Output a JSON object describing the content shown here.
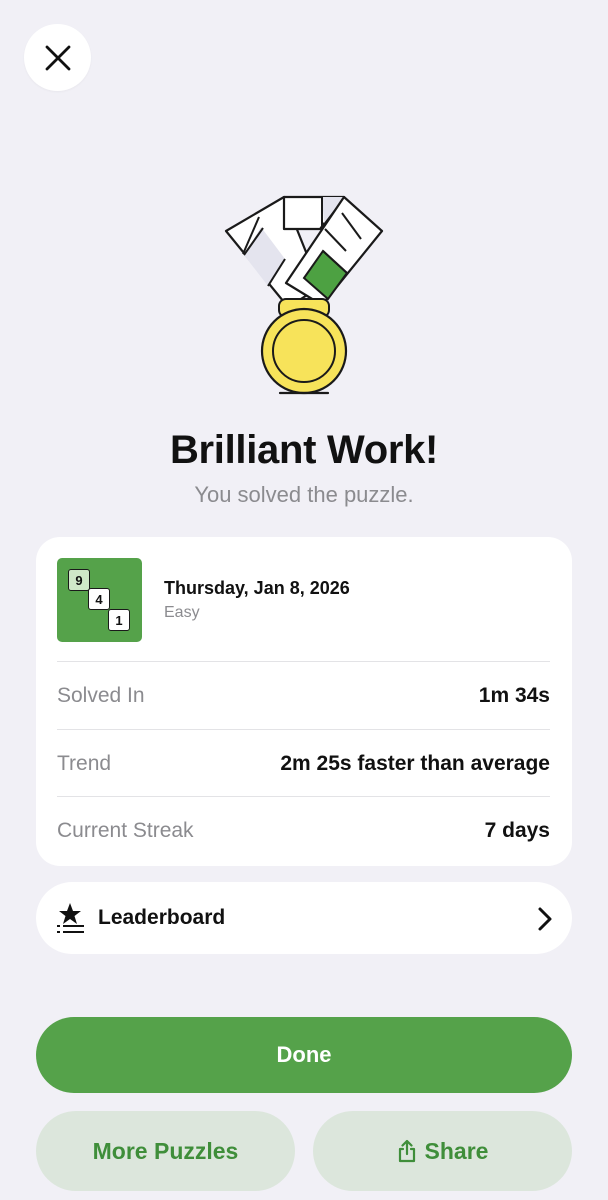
{
  "header": {
    "close_icon": "close-icon"
  },
  "celebration": {
    "medal_icon": "medal-icon",
    "title": "Brilliant Work!",
    "subtitle": "You solved the puzzle."
  },
  "puzzle": {
    "thumbnail_icon": "puzzle-thumbnail-icon",
    "thumbnail_tiles": [
      "9",
      "4",
      "1"
    ],
    "date": "Thursday, Jan 8, 2026",
    "difficulty": "Easy"
  },
  "stats": [
    {
      "label": "Solved In",
      "value": "1m 34s"
    },
    {
      "label": "Trend",
      "value": "2m 25s faster than average"
    },
    {
      "label": "Current Streak",
      "value": "7 days"
    }
  ],
  "leaderboard": {
    "icon": "leaderboard-icon",
    "label": "Leaderboard",
    "chevron": "chevron-right-icon"
  },
  "actions": {
    "done_label": "Done",
    "more_puzzles_label": "More Puzzles",
    "share_label": "Share",
    "share_icon": "share-icon"
  },
  "colors": {
    "accent_green": "#55a24a",
    "secondary_button_bg": "#dce6dc",
    "secondary_button_text": "#3f8e3a",
    "background": "#f1f0f6",
    "medal_gold": "#f7e35a"
  }
}
